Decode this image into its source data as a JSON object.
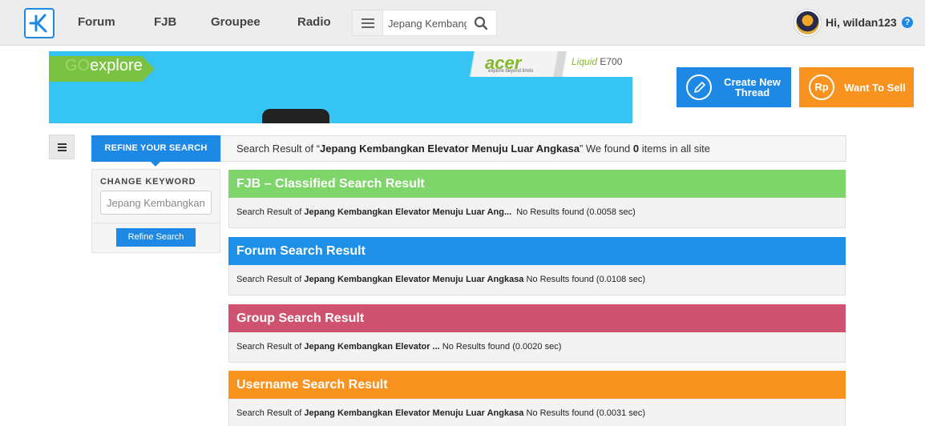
{
  "nav": {
    "links": [
      "Forum",
      "FJB",
      "Groupee",
      "Radio"
    ],
    "search_value": "Jepang Kembangkan",
    "greeting": "Hi, wildan123",
    "help": "?"
  },
  "banner": {
    "go_prefix": "GO",
    "go_word": "explore",
    "brand": "acer",
    "brand_tagline": "explore beyond limits",
    "model_prefix": "Liquid",
    "model_name": "E700"
  },
  "actions": {
    "create_label": "Create New Thread",
    "sell_icon": "Rp",
    "sell_label": "Want To Sell"
  },
  "refine": {
    "tab_label": "REFINE YOUR SEARCH",
    "keyword_title": "CHANGE KEYWORD",
    "keyword_value": "Jepang Kembangkan",
    "button_label": "Refine Search"
  },
  "summary": {
    "prefix": "Search Result of “",
    "query": "Jepang Kembangkan Elevator Menuju Luar Angkasa",
    "middle": "” We found ",
    "count": "0",
    "suffix": " items in all site"
  },
  "results": [
    {
      "title": "FJB – Classified Search Result",
      "color": "#7ed56a",
      "lead": "Search Result of ",
      "query": "Jepang Kembangkan Elevator Menuju Luar Ang...",
      "status": "  No Results found (0.0058 sec)"
    },
    {
      "title": "Forum Search Result",
      "color": "#1e90e8",
      "lead": "Search Result of ",
      "query": "Jepang Kembangkan Elevator Menuju Luar Angkasa",
      "status": " No Results found (0.0108 sec)"
    },
    {
      "title": "Group Search Result",
      "color": "#cf5270",
      "lead": "Search Result of ",
      "query": "Jepang Kembangkan Elevator ...",
      "status": " No Results found (0.0020 sec)"
    },
    {
      "title": "Username Search Result",
      "color": "#f7931e",
      "lead": "Search Result of ",
      "query": "Jepang Kembangkan Elevator Menuju Luar Angkasa",
      "status": " No Results found (0.0031 sec)"
    }
  ]
}
